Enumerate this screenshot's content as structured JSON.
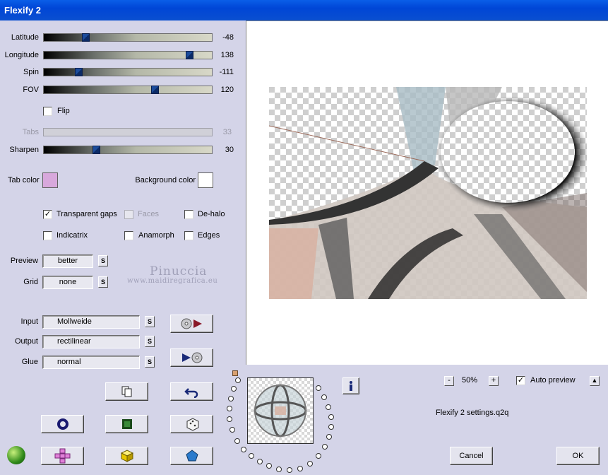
{
  "window": {
    "title": "Flexify 2"
  },
  "sliders": [
    {
      "label": "Latitude",
      "value": "-48",
      "position": 0.25,
      "enabled": true
    },
    {
      "label": "Longitude",
      "value": "138",
      "position": 0.87,
      "enabled": true
    },
    {
      "label": "Spin",
      "value": "-111",
      "position": 0.19,
      "enabled": true
    },
    {
      "label": "FOV",
      "value": "120",
      "position": 0.67,
      "enabled": true
    },
    {
      "label": "Tabs",
      "value": "33",
      "position": null,
      "enabled": false
    },
    {
      "label": "Sharpen",
      "value": "30",
      "position": 0.29,
      "enabled": true
    }
  ],
  "flip": {
    "label": "Flip",
    "checked": false
  },
  "colors": {
    "tab_label": "Tab color",
    "tab_color": "#d8a8dc",
    "background_label": "Background color",
    "background_color": "#ffffff"
  },
  "options": {
    "transparent_gaps": {
      "label": "Transparent gaps",
      "checked": true
    },
    "faces": {
      "label": "Faces",
      "checked": false,
      "enabled": false
    },
    "dehalo": {
      "label": "De-halo",
      "checked": false
    },
    "indicatrix": {
      "label": "Indicatrix",
      "checked": false
    },
    "anamorph": {
      "label": "Anamorph",
      "checked": false
    },
    "edges": {
      "label": "Edges",
      "checked": false
    }
  },
  "preview_quality": {
    "label": "Preview",
    "value": "better"
  },
  "grid": {
    "label": "Grid",
    "value": "none"
  },
  "watermark": {
    "name": "Pinuccia",
    "url": "www.maidiregrafica.eu"
  },
  "projection": {
    "input_label": "Input",
    "input_value": "Mollweide",
    "output_label": "Output",
    "output_value": "rectilinear",
    "glue_label": "Glue",
    "glue_value": "normal",
    "s_label": "S"
  },
  "zoom": {
    "value": "50%",
    "minus": "-",
    "plus": "+"
  },
  "auto_preview": {
    "label": "Auto preview",
    "checked": true
  },
  "settings_file": "Flexify 2 settings.q2q",
  "buttons": {
    "cancel": "Cancel",
    "ok": "OK"
  },
  "accent_colors": {
    "title_bar": "#0a5ee8",
    "panel": "#d4d4e8"
  }
}
